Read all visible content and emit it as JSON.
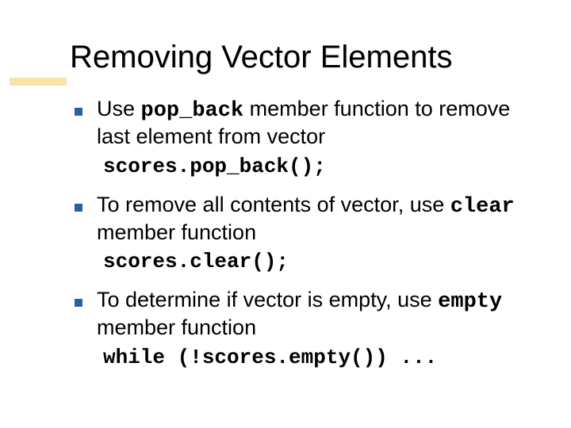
{
  "title": "Removing Vector Elements",
  "bullets": [
    {
      "pre": "Use ",
      "kw": "pop_back",
      "post": " member function to remove last element from vector",
      "code": "scores.pop_back();"
    },
    {
      "pre": "To remove all contents of vector, use ",
      "kw": "clear",
      "post": " member function",
      "code": "scores.clear();"
    },
    {
      "pre": "To determine if vector is empty, use ",
      "kw": "empty",
      "post": " member function",
      "code": "while (!scores.empty()) ..."
    }
  ]
}
